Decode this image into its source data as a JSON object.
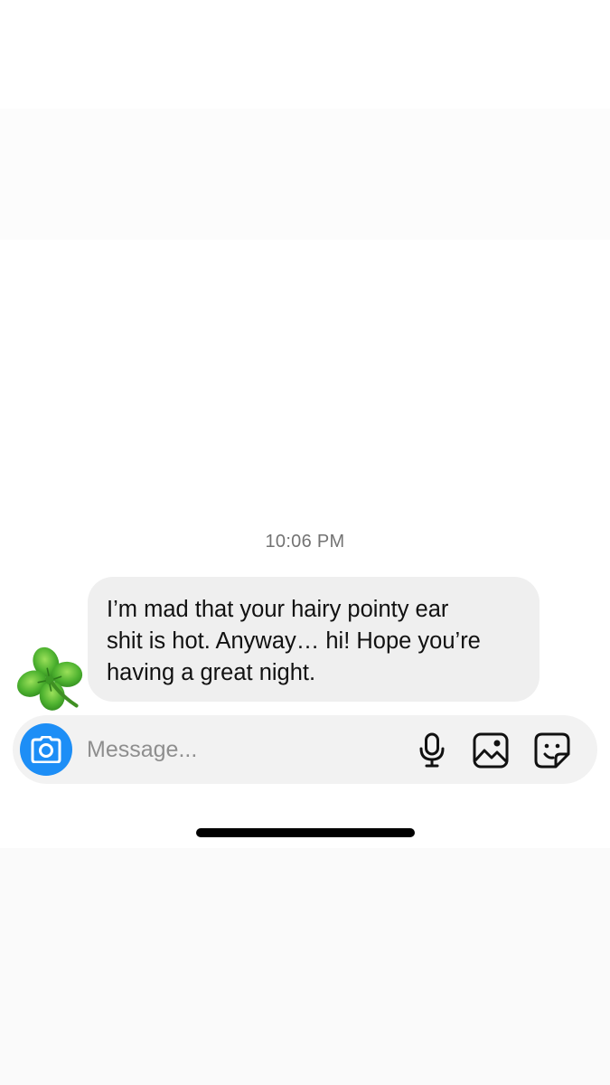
{
  "conversation": {
    "timestamp": "10:06 PM",
    "message": {
      "text": "I’m mad that your hairy pointy ear\nshit is hot. Anyway… hi! Hope you’re\nhaving a great night.",
      "sender_avatar_icon": "four-leaf-clover-icon",
      "bubble_color": "#efefef"
    }
  },
  "composer": {
    "placeholder": "Message...",
    "value": "",
    "camera_icon": "camera-icon",
    "camera_color": "#1d8ef6",
    "tools": [
      "microphone-icon",
      "gallery-icon",
      "sticker-icon"
    ]
  }
}
